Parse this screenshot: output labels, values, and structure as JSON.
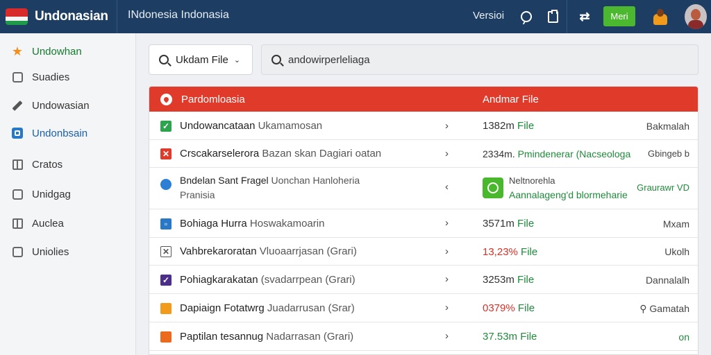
{
  "header": {
    "brand": "Undonasian",
    "title": "INdonesia  Indonasia",
    "version": "Versioi",
    "cta_label": "Meri"
  },
  "colors": {
    "header_bg": "#1d3e62",
    "accent_red": "#e03a2a",
    "accent_green": "#4cb82f",
    "link_blue": "#1a5fa8"
  },
  "sidebar": {
    "items": [
      {
        "label": "Undowhan",
        "icon": "star-icon"
      },
      {
        "label": "Suadies",
        "icon": "square-icon"
      },
      {
        "label": "Undowasian",
        "icon": "pencil-icon"
      },
      {
        "label": "Undonbsain",
        "icon": "blue-square-icon"
      },
      {
        "label": "Cratos",
        "icon": "grid-icon"
      },
      {
        "label": "Unidgag",
        "icon": "square-icon"
      },
      {
        "label": "Auclea",
        "icon": "calendar-icon"
      },
      {
        "label": "Uniolies",
        "icon": "copy-icon"
      }
    ]
  },
  "search": {
    "file_button": "Ukdam File",
    "value": "andowirperleliaga"
  },
  "table": {
    "header_col1": "Pardomloasia",
    "header_col2": "Andmar File",
    "rows": [
      {
        "title": "Undowancataan",
        "sub": "Ukamamosan",
        "size_num": "1382m",
        "size_file": "File",
        "status": "Bakmalah"
      },
      {
        "title": "Crscakarselerora",
        "sub": "Bazan skan Dagiari oatan",
        "size_num": "2334m.",
        "size_file": "Pmindenerar (Nacseologa",
        "status": "Gbingeb b"
      },
      {
        "title": "Bndelan Sant Fragel",
        "sub": "Uonchan Hanloheria",
        "line2": "Pranisia",
        "feature_line1": "Neltnorehla",
        "feature_line2": "Aannalageng'd blormeharie",
        "status": "Graurawr VD"
      },
      {
        "title": "Bohiaga Hurra",
        "sub": "Hoswakamoarin",
        "size_num": "3571m",
        "size_file": "File",
        "status": "Mxam"
      },
      {
        "title": "Vahbrekaroratan",
        "sub": "Vluoaarrjasan (Grari)",
        "size_num": "13,23%",
        "size_file": "File",
        "status": "Ukolh"
      },
      {
        "title": "Pohiagkarakatan",
        "sub": "(svadarrpean (Grari)",
        "size_num": "3253m",
        "size_file": "File",
        "status": "Dannalalh"
      },
      {
        "title": "Dapiaign Fotatwrg",
        "sub": "Juadarrusan (Srar)",
        "size_num": "0379%",
        "size_file": "File",
        "status": "Gamatah"
      },
      {
        "title": "Paptilan tesannug",
        "sub": "Nadarrasan (Grari)",
        "size_num": "37.53m",
        "size_file": "File",
        "status": "on"
      }
    ]
  }
}
